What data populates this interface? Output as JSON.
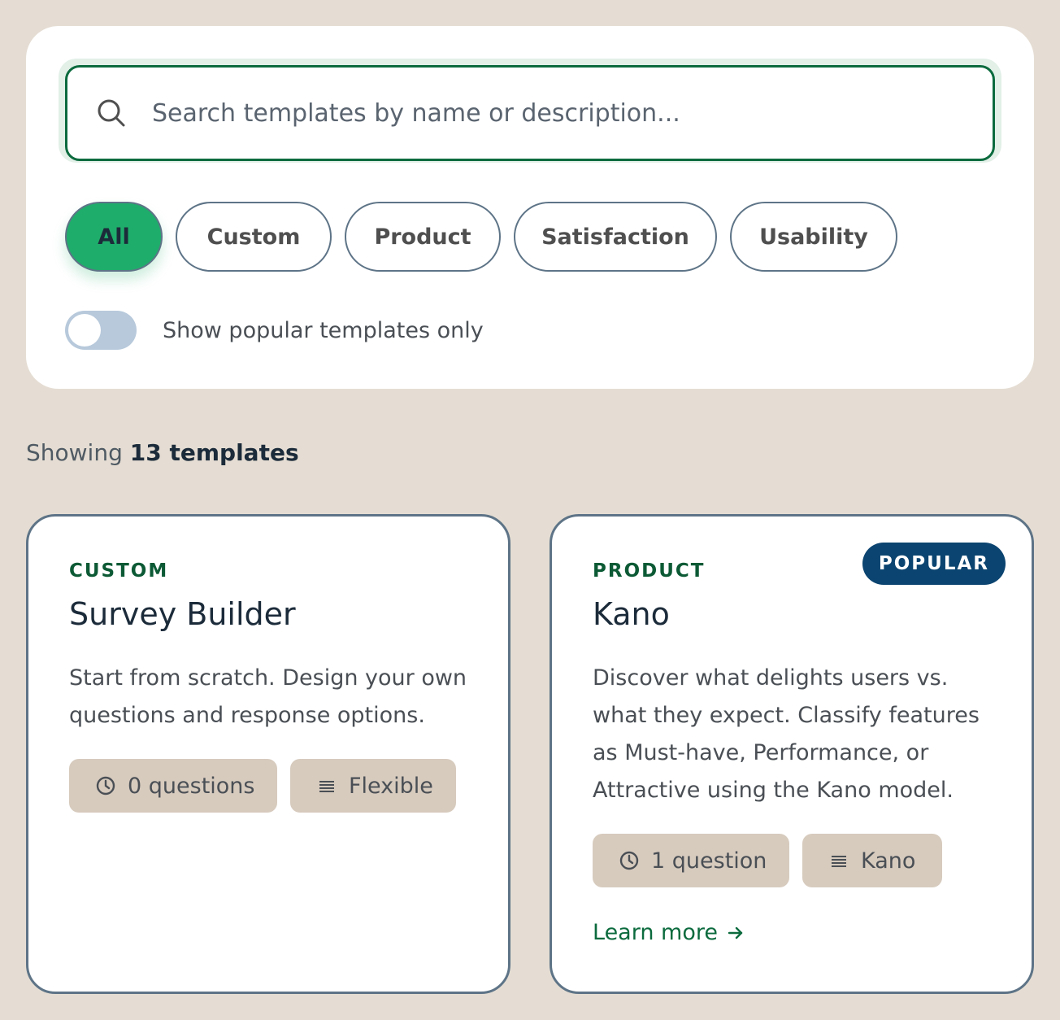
{
  "search": {
    "placeholder": "Search templates by name or description..."
  },
  "filters": {
    "chips": [
      "All",
      "Custom",
      "Product",
      "Satisfaction",
      "Usability"
    ],
    "active": "All"
  },
  "toggle": {
    "label": "Show popular templates only",
    "on": false
  },
  "results": {
    "prefix": "Showing",
    "count_text": "13 templates"
  },
  "cards": [
    {
      "category": "CUSTOM",
      "title": "Survey Builder",
      "description": "Start from scratch. Design your own questions and response options.",
      "questions": "0 questions",
      "type": "Flexible",
      "popular": false
    },
    {
      "category": "PRODUCT",
      "title": "Kano",
      "badge": "POPULAR",
      "description": "Discover what delights users vs. what they expect. Classify features as Must-have, Performance, or Attractive using the Kano model.",
      "questions": "1 question",
      "type": "Kano",
      "link": "Learn more",
      "popular": true
    }
  ],
  "colors": {
    "accent_green": "#1fad6b",
    "dark_green": "#0c6b3e",
    "popular_badge": "#0b4470",
    "background": "#e5ddd3",
    "pill": "#d7cbbe"
  }
}
